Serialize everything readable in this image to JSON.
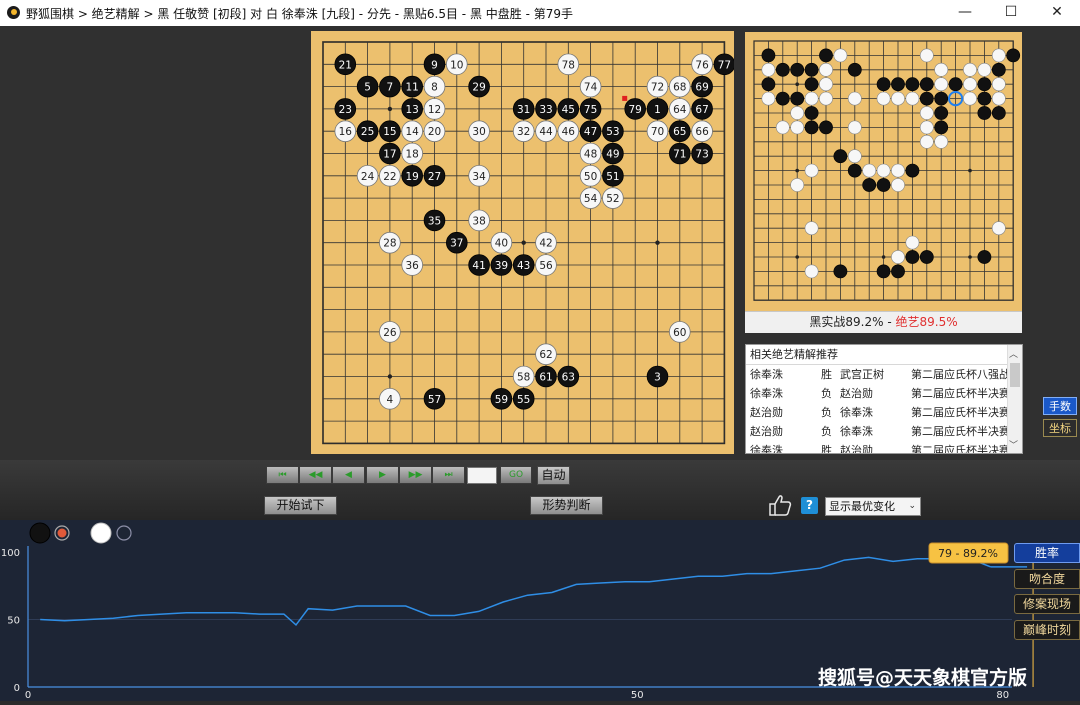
{
  "window": {
    "title": "野狐围棋 > 绝艺精解 > 黑 任敬赞 [初段] 对 白 徐奉洙 [九段] - 分先 - 黑贴6.5目 - 黑 中盘胜 - 第79手",
    "minimize": "—",
    "maximize": "☐",
    "close": "✕"
  },
  "board": {
    "size": 19,
    "last_move": 79,
    "marker_color": "#e02020",
    "stones": [
      {
        "c": "B",
        "col": 1,
        "row": 1,
        "n": 21
      },
      {
        "c": "B",
        "col": 5,
        "row": 1,
        "n": 9
      },
      {
        "c": "W",
        "col": 6,
        "row": 1,
        "n": 10
      },
      {
        "c": "W",
        "col": 11,
        "row": 1,
        "n": 78
      },
      {
        "c": "W",
        "col": 17,
        "row": 1,
        "n": 76
      },
      {
        "c": "B",
        "col": 18,
        "row": 1,
        "n": 77
      },
      {
        "c": "B",
        "col": 2,
        "row": 2,
        "n": 5
      },
      {
        "c": "B",
        "col": 3,
        "row": 2,
        "n": 7
      },
      {
        "c": "B",
        "col": 4,
        "row": 2,
        "n": 11
      },
      {
        "c": "W",
        "col": 5,
        "row": 2,
        "n": 8
      },
      {
        "c": "B",
        "col": 7,
        "row": 2,
        "n": 29
      },
      {
        "c": "W",
        "col": 12,
        "row": 2,
        "n": 74
      },
      {
        "c": "W",
        "col": 15,
        "row": 2,
        "n": 72
      },
      {
        "c": "W",
        "col": 16,
        "row": 2,
        "n": 68
      },
      {
        "c": "B",
        "col": 17,
        "row": 2,
        "n": 69
      },
      {
        "c": "B",
        "col": 1,
        "row": 3,
        "n": 23
      },
      {
        "c": "B",
        "col": 4,
        "row": 3,
        "n": 13
      },
      {
        "c": "W",
        "col": 5,
        "row": 3,
        "n": 12
      },
      {
        "c": "B",
        "col": 9,
        "row": 3,
        "n": 31
      },
      {
        "c": "B",
        "col": 10,
        "row": 3,
        "n": 33
      },
      {
        "c": "B",
        "col": 11,
        "row": 3,
        "n": 45
      },
      {
        "c": "B",
        "col": 12,
        "row": 3,
        "n": 75
      },
      {
        "c": "B",
        "col": 14,
        "row": 3,
        "n": 79
      },
      {
        "c": "B",
        "col": 15,
        "row": 3,
        "n": 1
      },
      {
        "c": "W",
        "col": 16,
        "row": 3,
        "n": 64
      },
      {
        "c": "B",
        "col": 17,
        "row": 3,
        "n": 67
      },
      {
        "c": "W",
        "col": 1,
        "row": 4,
        "n": 16
      },
      {
        "c": "B",
        "col": 2,
        "row": 4,
        "n": 25
      },
      {
        "c": "B",
        "col": 3,
        "row": 4,
        "n": 15
      },
      {
        "c": "W",
        "col": 4,
        "row": 4,
        "n": 14
      },
      {
        "c": "W",
        "col": 5,
        "row": 4,
        "n": 20
      },
      {
        "c": "W",
        "col": 7,
        "row": 4,
        "n": 30
      },
      {
        "c": "W",
        "col": 9,
        "row": 4,
        "n": 32
      },
      {
        "c": "W",
        "col": 10,
        "row": 4,
        "n": 44
      },
      {
        "c": "W",
        "col": 11,
        "row": 4,
        "n": 46
      },
      {
        "c": "B",
        "col": 12,
        "row": 4,
        "n": 47
      },
      {
        "c": "B",
        "col": 13,
        "row": 4,
        "n": 53
      },
      {
        "c": "W",
        "col": 15,
        "row": 4,
        "n": 70
      },
      {
        "c": "B",
        "col": 16,
        "row": 4,
        "n": 65
      },
      {
        "c": "W",
        "col": 17,
        "row": 4,
        "n": 66
      },
      {
        "c": "B",
        "col": 3,
        "row": 5,
        "n": 17
      },
      {
        "c": "W",
        "col": 4,
        "row": 5,
        "n": 18
      },
      {
        "c": "W",
        "col": 12,
        "row": 5,
        "n": 48
      },
      {
        "c": "B",
        "col": 13,
        "row": 5,
        "n": 49
      },
      {
        "c": "B",
        "col": 16,
        "row": 5,
        "n": 71
      },
      {
        "c": "B",
        "col": 17,
        "row": 5,
        "n": 73
      },
      {
        "c": "W",
        "col": 2,
        "row": 6,
        "n": 24
      },
      {
        "c": "W",
        "col": 3,
        "row": 6,
        "n": 22
      },
      {
        "c": "B",
        "col": 4,
        "row": 6,
        "n": 19
      },
      {
        "c": "B",
        "col": 5,
        "row": 6,
        "n": 27
      },
      {
        "c": "W",
        "col": 7,
        "row": 6,
        "n": 34
      },
      {
        "c": "W",
        "col": 12,
        "row": 6,
        "n": 50
      },
      {
        "c": "B",
        "col": 13,
        "row": 6,
        "n": 51
      },
      {
        "c": "W",
        "col": 12,
        "row": 7,
        "n": 54
      },
      {
        "c": "W",
        "col": 13,
        "row": 7,
        "n": 52
      },
      {
        "c": "B",
        "col": 5,
        "row": 8,
        "n": 35
      },
      {
        "c": "W",
        "col": 7,
        "row": 8,
        "n": 38
      },
      {
        "c": "W",
        "col": 3,
        "row": 9,
        "n": 28
      },
      {
        "c": "B",
        "col": 6,
        "row": 9,
        "n": 37
      },
      {
        "c": "W",
        "col": 8,
        "row": 9,
        "n": 40
      },
      {
        "c": "W",
        "col": 10,
        "row": 9,
        "n": 42
      },
      {
        "c": "W",
        "col": 4,
        "row": 10,
        "n": 36
      },
      {
        "c": "B",
        "col": 7,
        "row": 10,
        "n": 41
      },
      {
        "c": "B",
        "col": 8,
        "row": 10,
        "n": 39
      },
      {
        "c": "B",
        "col": 9,
        "row": 10,
        "n": 43
      },
      {
        "c": "W",
        "col": 10,
        "row": 10,
        "n": 56
      },
      {
        "c": "W",
        "col": 3,
        "row": 13,
        "n": 26
      },
      {
        "c": "W",
        "col": 16,
        "row": 13,
        "n": 60
      },
      {
        "c": "W",
        "col": 10,
        "row": 14,
        "n": 62
      },
      {
        "c": "W",
        "col": 9,
        "row": 15,
        "n": 58
      },
      {
        "c": "B",
        "col": 10,
        "row": 15,
        "n": 61
      },
      {
        "c": "B",
        "col": 11,
        "row": 15,
        "n": 63
      },
      {
        "c": "B",
        "col": 15,
        "row": 15,
        "n": 3
      },
      {
        "c": "W",
        "col": 3,
        "row": 16,
        "n": 4
      },
      {
        "c": "B",
        "col": 5,
        "row": 16,
        "n": 57
      },
      {
        "c": "B",
        "col": 8,
        "row": 16,
        "n": 59
      },
      {
        "c": "B",
        "col": 9,
        "row": 16,
        "n": 55
      }
    ]
  },
  "ai_board": {
    "size": 19,
    "highlight": {
      "col": 13,
      "row": 3
    },
    "stones": [
      {
        "c": "B",
        "col": 0,
        "row": 0
      },
      {
        "c": "B",
        "col": 4,
        "row": 0
      },
      {
        "c": "W",
        "col": 5,
        "row": 0
      },
      {
        "c": "W",
        "col": 11,
        "row": 0
      },
      {
        "c": "W",
        "col": 16,
        "row": 0
      },
      {
        "c": "B",
        "col": 17,
        "row": 0
      },
      {
        "c": "W",
        "col": 0,
        "row": 1
      },
      {
        "c": "B",
        "col": 1,
        "row": 1
      },
      {
        "c": "B",
        "col": 2,
        "row": 1
      },
      {
        "c": "B",
        "col": 3,
        "row": 1
      },
      {
        "c": "W",
        "col": 4,
        "row": 1
      },
      {
        "c": "B",
        "col": 6,
        "row": 1
      },
      {
        "c": "W",
        "col": 12,
        "row": 1
      },
      {
        "c": "W",
        "col": 14,
        "row": 1
      },
      {
        "c": "W",
        "col": 15,
        "row": 1
      },
      {
        "c": "B",
        "col": 16,
        "row": 1
      },
      {
        "c": "B",
        "col": 0,
        "row": 2
      },
      {
        "c": "B",
        "col": 3,
        "row": 2
      },
      {
        "c": "W",
        "col": 4,
        "row": 2
      },
      {
        "c": "B",
        "col": 8,
        "row": 2
      },
      {
        "c": "B",
        "col": 9,
        "row": 2
      },
      {
        "c": "B",
        "col": 10,
        "row": 2
      },
      {
        "c": "B",
        "col": 11,
        "row": 2
      },
      {
        "c": "W",
        "col": 12,
        "row": 2
      },
      {
        "c": "B",
        "col": 13,
        "row": 2
      },
      {
        "c": "W",
        "col": 14,
        "row": 2
      },
      {
        "c": "B",
        "col": 15,
        "row": 2
      },
      {
        "c": "W",
        "col": 16,
        "row": 2
      },
      {
        "c": "W",
        "col": 0,
        "row": 3
      },
      {
        "c": "B",
        "col": 1,
        "row": 3
      },
      {
        "c": "B",
        "col": 2,
        "row": 3
      },
      {
        "c": "W",
        "col": 3,
        "row": 3
      },
      {
        "c": "W",
        "col": 4,
        "row": 3
      },
      {
        "c": "W",
        "col": 6,
        "row": 3
      },
      {
        "c": "W",
        "col": 8,
        "row": 3
      },
      {
        "c": "W",
        "col": 9,
        "row": 3
      },
      {
        "c": "W",
        "col": 10,
        "row": 3
      },
      {
        "c": "B",
        "col": 11,
        "row": 3
      },
      {
        "c": "B",
        "col": 12,
        "row": 3
      },
      {
        "c": "W",
        "col": 14,
        "row": 3
      },
      {
        "c": "B",
        "col": 15,
        "row": 3
      },
      {
        "c": "W",
        "col": 16,
        "row": 3
      },
      {
        "c": "W",
        "col": 2,
        "row": 4
      },
      {
        "c": "B",
        "col": 3,
        "row": 4
      },
      {
        "c": "W",
        "col": 11,
        "row": 4
      },
      {
        "c": "B",
        "col": 12,
        "row": 4
      },
      {
        "c": "B",
        "col": 15,
        "row": 4
      },
      {
        "c": "B",
        "col": 16,
        "row": 4
      },
      {
        "c": "W",
        "col": 1,
        "row": 5
      },
      {
        "c": "W",
        "col": 2,
        "row": 5
      },
      {
        "c": "B",
        "col": 3,
        "row": 5
      },
      {
        "c": "B",
        "col": 4,
        "row": 5
      },
      {
        "c": "W",
        "col": 6,
        "row": 5
      },
      {
        "c": "W",
        "col": 11,
        "row": 5
      },
      {
        "c": "B",
        "col": 12,
        "row": 5
      },
      {
        "c": "W",
        "col": 11,
        "row": 6
      },
      {
        "c": "W",
        "col": 12,
        "row": 6
      },
      {
        "c": "B",
        "col": 5,
        "row": 7
      },
      {
        "c": "W",
        "col": 6,
        "row": 7
      },
      {
        "c": "W",
        "col": 3,
        "row": 8
      },
      {
        "c": "B",
        "col": 6,
        "row": 8
      },
      {
        "c": "W",
        "col": 7,
        "row": 8
      },
      {
        "c": "W",
        "col": 8,
        "row": 8
      },
      {
        "c": "W",
        "col": 9,
        "row": 8
      },
      {
        "c": "B",
        "col": 10,
        "row": 8
      },
      {
        "c": "W",
        "col": 2,
        "row": 9
      },
      {
        "c": "B",
        "col": 7,
        "row": 9
      },
      {
        "c": "B",
        "col": 8,
        "row": 9
      },
      {
        "c": "W",
        "col": 9,
        "row": 9
      },
      {
        "c": "W",
        "col": 3,
        "row": 12
      },
      {
        "c": "W",
        "col": 16,
        "row": 12
      },
      {
        "c": "W",
        "col": 10,
        "row": 13
      },
      {
        "c": "W",
        "col": 9,
        "row": 14
      },
      {
        "c": "B",
        "col": 10,
        "row": 14
      },
      {
        "c": "B",
        "col": 11,
        "row": 14
      },
      {
        "c": "B",
        "col": 15,
        "row": 14
      },
      {
        "c": "W",
        "col": 3,
        "row": 15
      },
      {
        "c": "B",
        "col": 5,
        "row": 15
      },
      {
        "c": "B",
        "col": 8,
        "row": 15
      },
      {
        "c": "B",
        "col": 9,
        "row": 15
      }
    ]
  },
  "winrate": {
    "prefix": "黑实战89.2% - ",
    "ai_label": "绝艺89.5%",
    "ai_color": "#e03030"
  },
  "recommendations": {
    "header": "相关绝艺精解推荐",
    "rows": [
      {
        "p1": "徐奉洙",
        "result": "胜",
        "p2": "武宫正树",
        "event": "第二届应氏杯八强战"
      },
      {
        "p1": "徐奉洙",
        "result": "负",
        "p2": "赵治勋",
        "event": "第二届应氏杯半决赛"
      },
      {
        "p1": "赵治勋",
        "result": "负",
        "p2": "徐奉洙",
        "event": "第二届应氏杯半决赛"
      },
      {
        "p1": "赵治勋",
        "result": "负",
        "p2": "徐奉洙",
        "event": "第二届应氏杯半决赛"
      },
      {
        "p1": "徐奉洙",
        "result": "胜",
        "p2": "赵治勋",
        "event": "第二届应氏杯半决赛"
      }
    ],
    "scroll_down_icon": "chevron-down-icon"
  },
  "side_buttons": {
    "move_numbers": "手数",
    "coordinates": "坐标"
  },
  "controls": {
    "first": "⏮",
    "back10": "◀◀",
    "back": "◀",
    "forward": "▶",
    "forward10": "▶▶",
    "last": "⏭",
    "go": "GO",
    "auto": "自动",
    "start_trial": "开始试下",
    "situation": "形势判断",
    "help": "?",
    "variation_select": "显示最优变化",
    "variation_arrow": "⌄"
  },
  "graph": {
    "tabs": [
      "胜率",
      "吻合度",
      "修案现场",
      "巅峰时刻"
    ],
    "tooltip": "79 - 89.2%",
    "y_ticks": [
      100,
      50,
      0
    ],
    "x_ticks": [
      0,
      50,
      80
    ],
    "indicator_colors": {
      "black": "#111111",
      "white": "#ffffff",
      "accent": "#e05a3a"
    }
  },
  "chart_data": {
    "type": "line",
    "title": "",
    "xlabel": "",
    "ylabel": "",
    "xlim": [
      0,
      86
    ],
    "ylim": [
      0,
      100
    ],
    "series": [
      {
        "color": "#2f8ee6",
        "x": [
          1,
          3,
          5,
          7,
          9,
          11,
          13,
          15,
          17,
          19,
          21,
          22,
          23,
          25,
          27,
          29,
          31,
          33,
          35,
          37,
          39,
          41,
          43,
          45,
          47,
          49,
          51,
          53,
          55,
          57,
          59,
          61,
          63,
          65,
          67,
          69,
          71,
          73,
          75,
          77,
          79
        ],
        "y": [
          50,
          49,
          50,
          51,
          53,
          54,
          55,
          55,
          55,
          54,
          54,
          46,
          58,
          57,
          60,
          60,
          60,
          53,
          53,
          56,
          63,
          68,
          70,
          76,
          77,
          78,
          78,
          80,
          82,
          82,
          84,
          84,
          86,
          88,
          94,
          96,
          93,
          95,
          95,
          96,
          89
        ]
      }
    ],
    "end_x": [
      79,
      82
    ],
    "end_y": [
      89,
      89
    ]
  },
  "watermark": "搜狐号@天天象棋官方版"
}
